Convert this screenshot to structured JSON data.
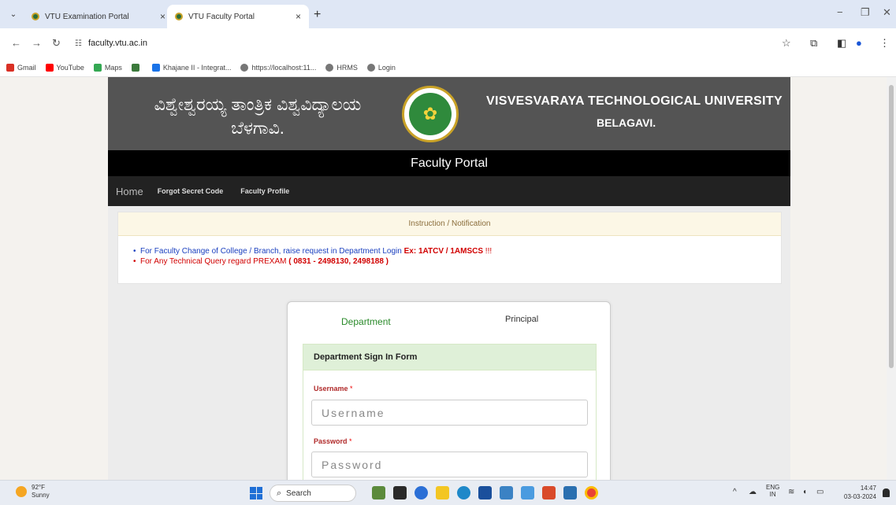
{
  "browser": {
    "tabs": [
      {
        "title": "VTU Examination Portal",
        "active": false
      },
      {
        "title": "VTU Faculty Portal",
        "active": true
      }
    ],
    "url": "faculty.vtu.ac.in",
    "bookmarks": [
      "Gmail",
      "YouTube",
      "Maps",
      "",
      "Khajane II - Integrat...",
      "https://localhost:11...",
      "HRMS",
      "Login"
    ]
  },
  "header": {
    "kannada_line1": "ವಿಶ್ವೇಶ್ವರಯ್ಯ ತಾಂತ್ರಿಕ ವಿಶ್ವವಿದ್ಯಾಲಯ",
    "kannada_line2": "ಬೆಳಗಾವಿ.",
    "english_title": "VISVESVARAYA TECHNOLOGICAL UNIVERSITY",
    "english_subtitle": "BELAGAVI."
  },
  "portal_title": "Faculty Portal",
  "menu": {
    "home": "Home",
    "items": [
      "Forgot Secret Code",
      "Faculty Profile"
    ]
  },
  "notice": {
    "heading": "Instruction / Notification",
    "line1_text": "For Faculty Change of College / Branch, raise request in Department Login ",
    "line1_example": "Ex: 1ATCV / 1AMSCS",
    "line1_suffix": " !!!",
    "line2_text": "For Any Technical Query regard PREXAM ",
    "line2_phone": "( 0831 - 2498130, 2498188 )"
  },
  "login": {
    "tabs": [
      "Department",
      "Principal"
    ],
    "form_title": "Department Sign In Form",
    "username_label": "Username",
    "username_placeholder": "Username",
    "password_label": "Password",
    "password_placeholder": "Password",
    "required_mark": "*"
  },
  "taskbar": {
    "weather_temp": "92°F",
    "weather_desc": "Sunny",
    "search_label": "Search",
    "lang_line1": "ENG",
    "lang_line2": "IN",
    "time": "14:47",
    "date": "03-03-2024"
  },
  "colors": {
    "header_bg": "#545454",
    "portal_bar_bg": "#000000",
    "menu_bg": "#222222",
    "notice_head_bg": "#fcf7e6",
    "form_head_bg": "#dff0d8",
    "active_tab_text": "#2a8a2a"
  }
}
